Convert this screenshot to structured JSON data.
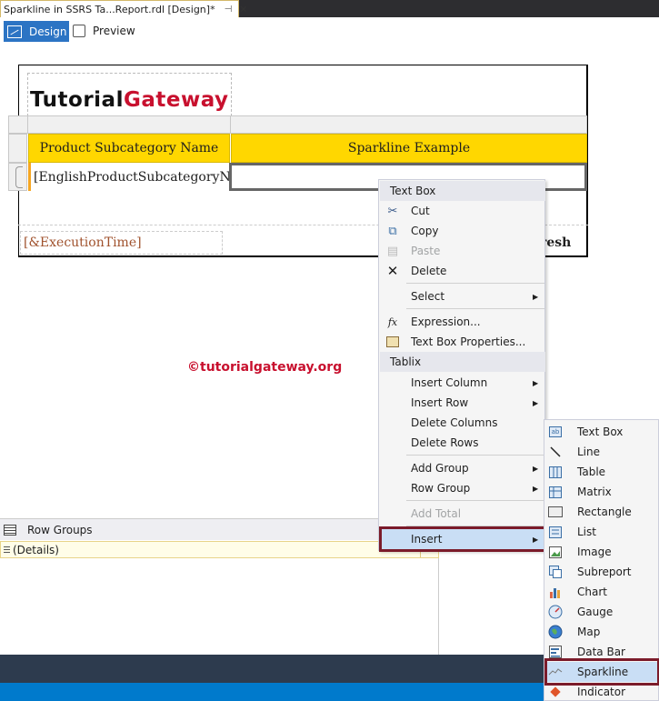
{
  "tab": {
    "title": "Sparkline in SSRS Ta...Report.rdl [Design]*",
    "pin": "⊣",
    "close": "✕"
  },
  "toolbar": {
    "design_label": "Design",
    "preview_label": "Preview"
  },
  "report": {
    "logo_part1": "Tutorial",
    "logo_part2": "Gateway",
    "header_col1": "Product Subcategory Name",
    "header_col2": "Sparkline Example",
    "detail_col1": "[EnglishProductSubcategoryNa",
    "footer_left": "[&ExecutionTime]",
    "footer_right": "resh"
  },
  "watermark": "©tutorialgateway.org",
  "row_groups": {
    "title": "Row Groups",
    "details": "(Details)"
  },
  "context_menu": {
    "section_textbox": "Text Box",
    "cut": "Cut",
    "copy": "Copy",
    "paste": "Paste",
    "delete": "Delete",
    "select": "Select",
    "expression": "Expression...",
    "textbox_props": "Text Box Properties...",
    "section_tablix": "Tablix",
    "insert_column": "Insert Column",
    "insert_row": "Insert Row",
    "delete_columns": "Delete Columns",
    "delete_rows": "Delete Rows",
    "add_group": "Add Group",
    "row_group": "Row Group",
    "add_total": "Add Total",
    "insert": "Insert"
  },
  "insert_submenu": {
    "items": [
      "Text Box",
      "Line",
      "Table",
      "Matrix",
      "Rectangle",
      "List",
      "Image",
      "Subreport",
      "Chart",
      "Gauge",
      "Map",
      "Data Bar",
      "Sparkline",
      "Indicator"
    ]
  }
}
